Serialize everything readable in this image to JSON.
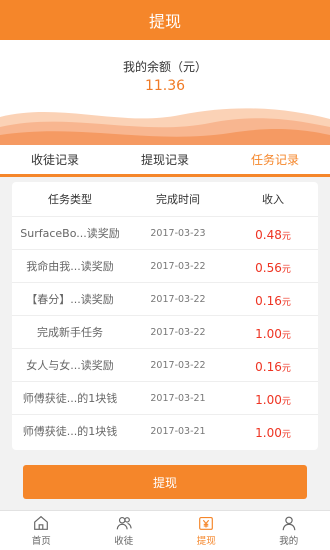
{
  "header": {
    "title": "提现"
  },
  "balance": {
    "label": "我的余额（元）",
    "value": "11.36"
  },
  "colors": {
    "accent": "#f5862a",
    "amount": "#ee3322"
  },
  "tabs": [
    {
      "label": "收徒记录"
    },
    {
      "label": "提现记录"
    },
    {
      "label": "任务记录"
    }
  ],
  "table": {
    "headers": [
      "任务类型",
      "完成时间",
      "收入"
    ],
    "unit": "元",
    "rows": [
      {
        "type": "SurfaceBo...读奖励",
        "date": "2017-03-23",
        "amount": "0.48"
      },
      {
        "type": "我命由我...读奖励",
        "date": "2017-03-22",
        "amount": "0.56"
      },
      {
        "type": "【春分】...读奖励",
        "date": "2017-03-22",
        "amount": "0.16"
      },
      {
        "type": "完成新手任务",
        "date": "2017-03-22",
        "amount": "1.00"
      },
      {
        "type": "女人与女...读奖励",
        "date": "2017-03-22",
        "amount": "0.16"
      },
      {
        "type": "师傅获徒...的1块钱",
        "date": "2017-03-21",
        "amount": "1.00"
      },
      {
        "type": "师傅获徒...的1块钱",
        "date": "2017-03-21",
        "amount": "1.00"
      }
    ]
  },
  "withdraw_button": {
    "label": "提现"
  },
  "bottom_nav": [
    {
      "label": "首页",
      "icon": "home-icon"
    },
    {
      "label": "收徒",
      "icon": "users-icon"
    },
    {
      "label": "提现",
      "icon": "yen-icon"
    },
    {
      "label": "我的",
      "icon": "person-icon"
    }
  ]
}
